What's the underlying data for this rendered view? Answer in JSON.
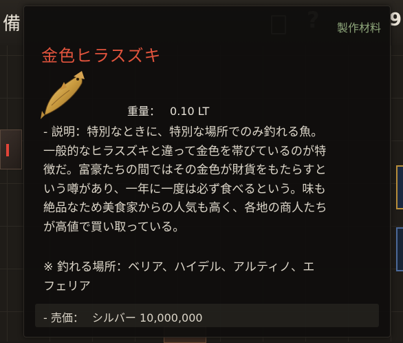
{
  "background": {
    "title": "備",
    "number": "9",
    "help_icon": "question-mark-icon",
    "doc_icon": "document-icon"
  },
  "tooltip": {
    "category": "製作材料",
    "item_name": "金色ヒラスズキ",
    "item_icon": "golden-fish-icon",
    "weight_label": "重量：",
    "weight_value": "0.10 LT",
    "description": "- 説明：特別なときに、特別な場所でのみ釣れる魚。\n一般的なヒラスズキと違って金色を帯びているのが特\n徴だ。富豪たちの間ではその金色が財貨をもたらすと\nいう噂があり、一年に一度は必ず食べるという。味も\n絶品なため美食家からの人気も高く、各地の商人たち\nが高値で買い取っている。",
    "location": "※ 釣れる場所：ベリア、ハイデル、アルティノ、エ\nフェリア",
    "price_label": "- 売価：",
    "price_value": "シルバー 10,000,000"
  },
  "colors": {
    "item_name": "#e2543d",
    "category": "#8ea67a",
    "text": "#dcd6c9"
  }
}
